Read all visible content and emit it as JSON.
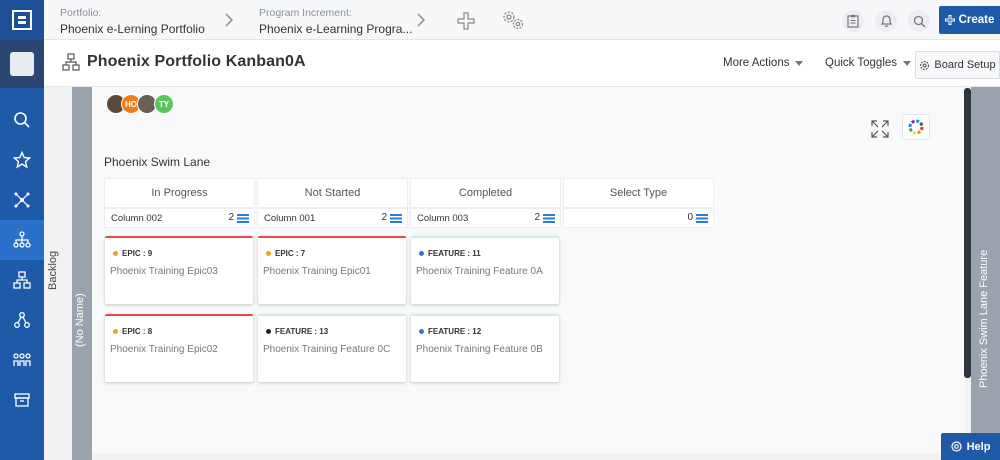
{
  "header": {
    "breadcrumbs": [
      {
        "label": "Portfolio:",
        "value": "Phoenix e-Lerning Portfolio"
      },
      {
        "label": "Program Increment:",
        "value": "Phoenix e-Learning Progra..."
      }
    ],
    "create_label": "Create"
  },
  "titlebar": {
    "title": "Phoenix Portfolio Kanban0A",
    "more_actions": "More Actions",
    "quick_toggles": "Quick Toggles",
    "board_setup": "Board Setup"
  },
  "board": {
    "backlog_label": "Backlog",
    "left_lane_label": "(No Name)",
    "right_lane_label": "Phoenix Swim Lane Feature",
    "avatars": [
      {
        "initials": "",
        "color": "#5b4a3c"
      },
      {
        "initials": "HO",
        "color": "#f07c1e"
      },
      {
        "initials": "",
        "color": "#6a5e55"
      },
      {
        "initials": "TY",
        "color": "#5cc45f"
      }
    ],
    "swim_lane_title": "Phoenix Swim Lane",
    "columns": [
      {
        "header": "In Progress",
        "sub": "Column 002",
        "count": "2"
      },
      {
        "header": "Not Started",
        "sub": "Column 001",
        "count": "2"
      },
      {
        "header": "Completed",
        "sub": "Column 003",
        "count": "2"
      },
      {
        "header": "Select Type",
        "sub": "",
        "count": "0"
      }
    ],
    "cards": [
      {
        "type": "EPIC : 9",
        "title": "Phoenix Training Epic03",
        "dot": "#f0a020",
        "kind": "epic"
      },
      {
        "type": "EPIC : 7",
        "title": "Phoenix Training Epic01",
        "dot": "#f0a020",
        "kind": "epic"
      },
      {
        "type": "FEATURE : 11",
        "title": "Phoenix Training Feature 0A",
        "dot": "#3a78d0",
        "kind": "feature"
      },
      {
        "type": "EPIC : 8",
        "title": "Phoenix Training Epic02",
        "dot": "#f0a020",
        "kind": "epic"
      },
      {
        "type": "FEATURE : 13",
        "title": "Phoenix Training Feature 0C",
        "dot": "#222222",
        "kind": "feature"
      },
      {
        "type": "FEATURE : 12",
        "title": "Phoenix Training Feature 0B",
        "dot": "#3a78d0",
        "kind": "feature"
      }
    ]
  },
  "help_label": "Help",
  "colors": {
    "brand": "#1f5aa8",
    "epic_border": "#e24c4c",
    "lane": "#9aa2ad"
  }
}
